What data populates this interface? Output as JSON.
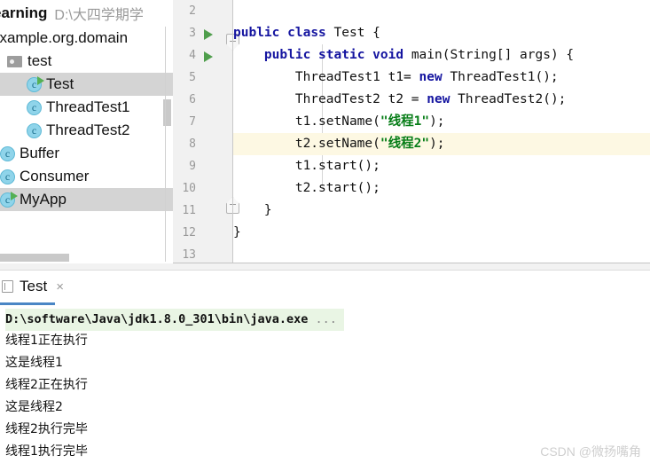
{
  "window": {
    "project_name": "earning",
    "project_path": "D:\\大四学期学"
  },
  "sidebar": {
    "items": [
      {
        "label": "example.org.domain",
        "icon": "package-icon",
        "indent": 0,
        "selected": false,
        "runnable": false
      },
      {
        "label": "test",
        "icon": "folder-icon",
        "indent": 8,
        "selected": false,
        "runnable": false
      },
      {
        "label": "Test",
        "icon": "class-icon",
        "indent": 30,
        "selected": true,
        "runnable": true
      },
      {
        "label": "ThreadTest1",
        "icon": "class-icon",
        "indent": 30,
        "selected": false,
        "runnable": false
      },
      {
        "label": "ThreadTest2",
        "icon": "class-icon",
        "indent": 30,
        "selected": false,
        "runnable": false
      },
      {
        "label": "Buffer",
        "icon": "class-icon",
        "indent": 0,
        "selected": false,
        "runnable": false
      },
      {
        "label": "Consumer",
        "icon": "class-icon",
        "indent": 0,
        "selected": false,
        "runnable": false
      },
      {
        "label": "MyApp",
        "icon": "class-icon",
        "indent": 0,
        "selected": true,
        "runnable": true
      }
    ]
  },
  "editor": {
    "lines": [
      {
        "num": "2",
        "run_arrow": false,
        "current": false,
        "indent": 0,
        "tokens": []
      },
      {
        "num": "3",
        "run_arrow": true,
        "current": false,
        "indent": 0,
        "tokens": [
          {
            "t": "kw",
            "v": "public"
          },
          {
            "t": "p",
            "v": " "
          },
          {
            "t": "kw",
            "v": "class"
          },
          {
            "t": "p",
            "v": " Test {"
          }
        ]
      },
      {
        "num": "4",
        "run_arrow": true,
        "current": false,
        "indent": 0,
        "tokens": [
          {
            "t": "p",
            "v": "    "
          },
          {
            "t": "kw",
            "v": "public"
          },
          {
            "t": "p",
            "v": " "
          },
          {
            "t": "kw",
            "v": "static"
          },
          {
            "t": "p",
            "v": " "
          },
          {
            "t": "kw",
            "v": "void"
          },
          {
            "t": "p",
            "v": " main(String[] args) {"
          }
        ]
      },
      {
        "num": "5",
        "run_arrow": false,
        "current": false,
        "indent": 0,
        "tokens": [
          {
            "t": "p",
            "v": "        ThreadTest1 t1= "
          },
          {
            "t": "kw",
            "v": "new"
          },
          {
            "t": "p",
            "v": " ThreadTest1();"
          }
        ]
      },
      {
        "num": "6",
        "run_arrow": false,
        "current": false,
        "indent": 0,
        "tokens": [
          {
            "t": "p",
            "v": "        ThreadTest2 t2 = "
          },
          {
            "t": "kw",
            "v": "new"
          },
          {
            "t": "p",
            "v": " ThreadTest2();"
          }
        ]
      },
      {
        "num": "7",
        "run_arrow": false,
        "current": false,
        "indent": 0,
        "tokens": [
          {
            "t": "p",
            "v": "        t1.setName("
          },
          {
            "t": "str",
            "v": "\"线程1\""
          },
          {
            "t": "p",
            "v": ");"
          }
        ]
      },
      {
        "num": "8",
        "run_arrow": false,
        "current": true,
        "indent": 0,
        "tokens": [
          {
            "t": "p",
            "v": "        t2.setName("
          },
          {
            "t": "str",
            "v": "\"线程2\""
          },
          {
            "t": "p",
            "v": ");"
          }
        ]
      },
      {
        "num": "9",
        "run_arrow": false,
        "current": false,
        "indent": 0,
        "tokens": [
          {
            "t": "p",
            "v": "        t1.start();"
          }
        ]
      },
      {
        "num": "10",
        "run_arrow": false,
        "current": false,
        "indent": 0,
        "tokens": [
          {
            "t": "p",
            "v": "        t2.start();"
          }
        ]
      },
      {
        "num": "11",
        "run_arrow": false,
        "current": false,
        "indent": 0,
        "tokens": [
          {
            "t": "p",
            "v": "    }"
          }
        ]
      },
      {
        "num": "12",
        "run_arrow": false,
        "current": false,
        "indent": 0,
        "tokens": [
          {
            "t": "p",
            "v": "}"
          }
        ]
      },
      {
        "num": "13",
        "run_arrow": false,
        "current": false,
        "indent": 0,
        "tokens": []
      }
    ]
  },
  "console": {
    "tab_label": "Test",
    "close_label": "×",
    "command_line": "D:\\software\\Java\\jdk1.8.0_301\\bin\\java.exe",
    "command_ellipsis": " ...",
    "output": [
      "线程1正在执行",
      "这是线程1",
      "线程2正在执行",
      "这是线程2",
      "线程2执行完毕",
      "线程1执行完毕"
    ]
  },
  "watermark": {
    "text": "CSDN @微扬嘴角"
  },
  "colors": {
    "keyword": "#1515a0",
    "string": "#067d17",
    "current_line": "#fdf8e3",
    "selection": "#d4d4d4",
    "console_cmd_bg": "#e9f5e4",
    "run_arrow": "#4f9e4c",
    "tab_underline": "#4a86c5"
  }
}
